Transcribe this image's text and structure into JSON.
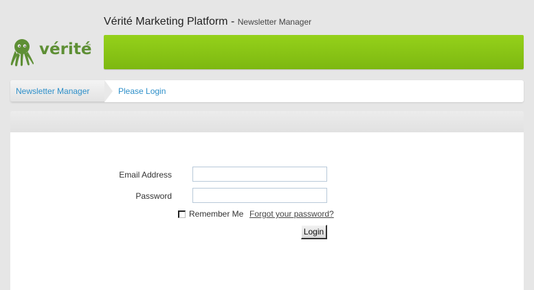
{
  "logo": {
    "text": "vérité",
    "tm": "™",
    "icon": "octopus-icon"
  },
  "header": {
    "title": "Vérité Marketing Platform",
    "separator": " - ",
    "subtitle": "Newsletter Manager"
  },
  "breadcrumb": {
    "items": [
      {
        "label": "Newsletter Manager"
      },
      {
        "label": "Please Login"
      }
    ]
  },
  "login_form": {
    "email_label": "Email Address",
    "email_value": "",
    "password_label": "Password",
    "password_value": "",
    "remember_label": "Remember Me",
    "remember_checked": false,
    "forgot_label": "Forgot your password?",
    "submit_label": "Login"
  },
  "colors": {
    "brand_green": "#7db811",
    "link_blue": "#2d8fc9",
    "logo_green": "#5e8f35"
  }
}
